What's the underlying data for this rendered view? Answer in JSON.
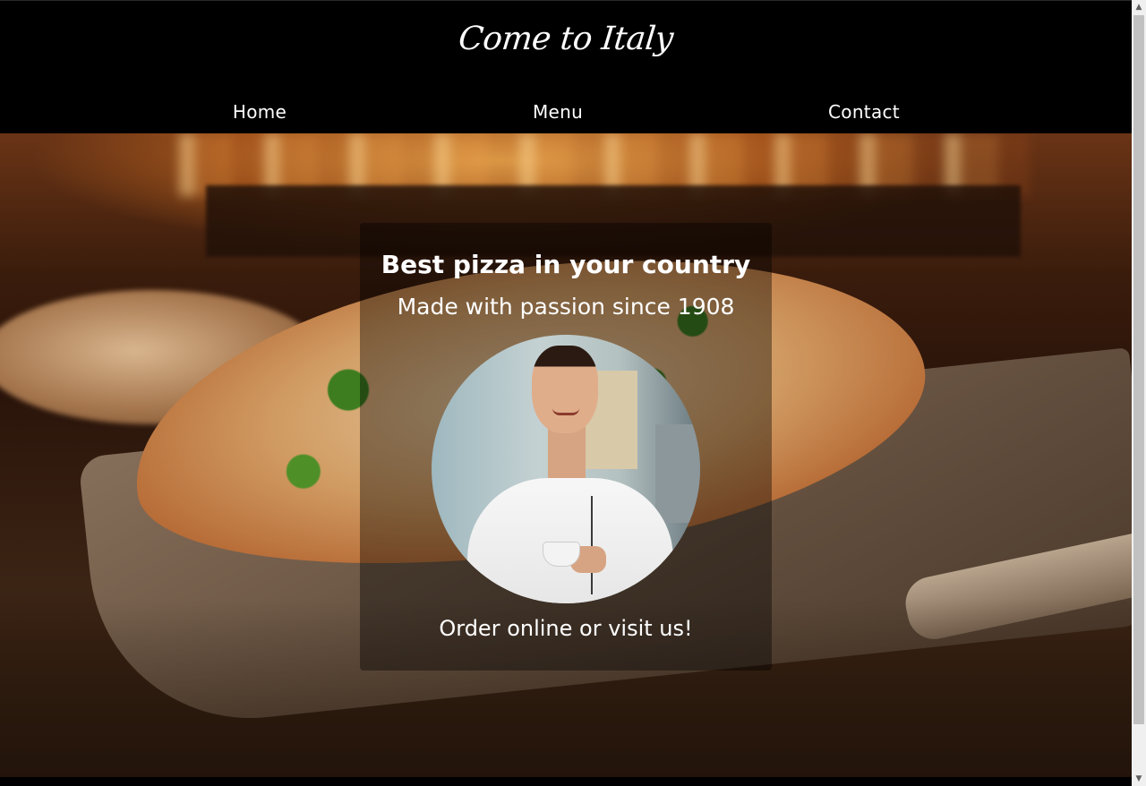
{
  "header": {
    "logo": "Come to Italy"
  },
  "nav": {
    "items": [
      {
        "label": "Home"
      },
      {
        "label": "Menu"
      },
      {
        "label": "Contact"
      }
    ]
  },
  "hero": {
    "headline": "Best pizza in your country",
    "subline": "Made with passion since 1908",
    "cta": "Order online or visit us!"
  },
  "scrollbar": {
    "up_icon": "▲",
    "down_icon": "▼"
  }
}
